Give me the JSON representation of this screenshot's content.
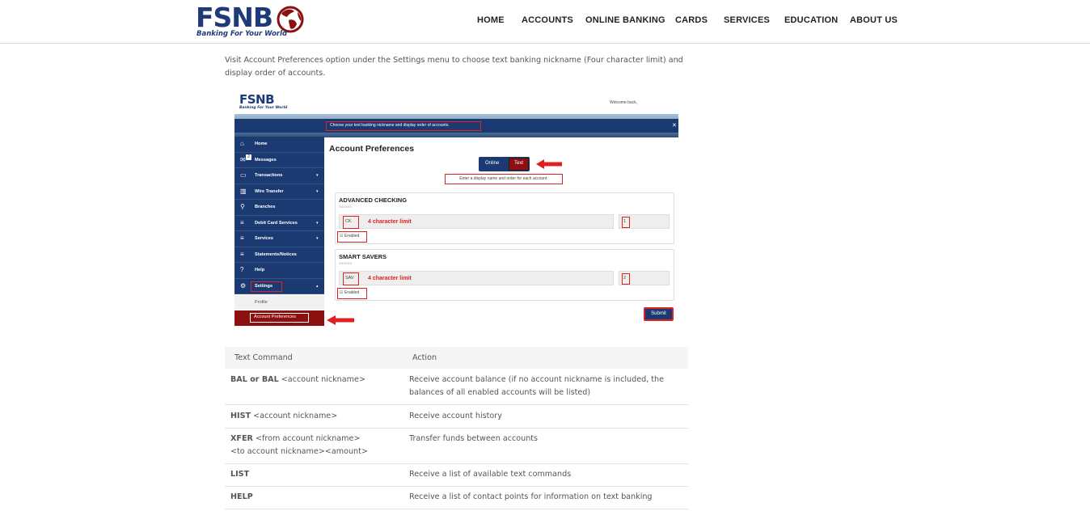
{
  "header": {
    "logo_text": "FSNB",
    "tagline": "Banking For Your World",
    "nav": [
      "HOME",
      "ACCOUNTS",
      "ONLINE BANKING",
      "CARDS",
      "SERVICES",
      "EDUCATION",
      "ABOUT US"
    ]
  },
  "intro": "Visit Account Preferences option under the Settings menu to choose text banking nickname (Four character limit) and display order of accounts.",
  "screenshot": {
    "logo_text": "FSNB",
    "tagline": "Banking For Your World",
    "welcome": "Welcome back,",
    "banner_message": "Choose your text banking nickname and display order of accounts.",
    "sidebar": [
      "Home",
      "Messages",
      "Transactions",
      "Wire Transfer",
      "Branches",
      "Debit Card Services",
      "Services",
      "Statements/Notices",
      "Help",
      "Settings"
    ],
    "messages_badge": "2",
    "sub_profile": "Profile",
    "sub_active": "Account Preferences",
    "title": "Account Preferences",
    "toggle_online": "Online",
    "toggle_text": "Text",
    "enter_message": "Enter a display name and order for each account.",
    "accounts": [
      {
        "name": "ADVANCED CHECKING",
        "mask": "XXXXXX",
        "nickname": "CK",
        "limit": "4 character limit",
        "order": "1",
        "enabled": "Enabled"
      },
      {
        "name": "SMART SAVERS",
        "mask": "XXXXXX",
        "nickname": "SAV",
        "limit": "4 character limit",
        "order": "2",
        "enabled": "Enabled"
      }
    ],
    "submit": "Submit"
  },
  "table": {
    "headers": [
      "Text Command",
      "Action"
    ],
    "rows": [
      {
        "cmd_bold": "BAL or BAL",
        "cmd_rest": " <account nickname>",
        "cmd_line2": "",
        "action": "Receive account balance (if no account nickname is included, the balances of all enabled accounts will be listed)"
      },
      {
        "cmd_bold": "HIST",
        "cmd_rest": " <account nickname>",
        "cmd_line2": "",
        "action": "Receive account history"
      },
      {
        "cmd_bold": "XFER",
        "cmd_rest": " <from account nickname>",
        "cmd_line2": "<to account nickname><amount>",
        "action": "Transfer funds between accounts"
      },
      {
        "cmd_bold": "LIST",
        "cmd_rest": "",
        "cmd_line2": "",
        "action": "Receive a list of available text commands"
      },
      {
        "cmd_bold": "HELP",
        "cmd_rest": "",
        "cmd_line2": "",
        "action": "Receive a list of contact points for information on text banking"
      }
    ]
  }
}
